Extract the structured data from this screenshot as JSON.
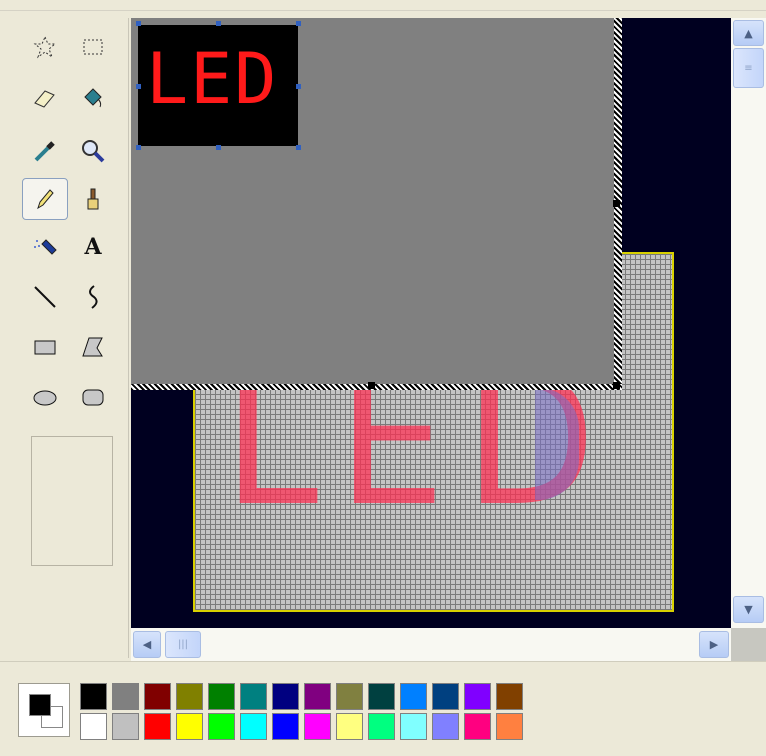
{
  "tools": [
    {
      "name": "free-select-icon"
    },
    {
      "name": "rect-select-icon"
    },
    {
      "name": "eraser-icon"
    },
    {
      "name": "fill-bucket-icon"
    },
    {
      "name": "color-picker-icon"
    },
    {
      "name": "magnifier-icon"
    },
    {
      "name": "pencil-icon",
      "selected": true
    },
    {
      "name": "brush-icon"
    },
    {
      "name": "airbrush-icon"
    },
    {
      "name": "text-icon"
    },
    {
      "name": "line-icon"
    },
    {
      "name": "curve-icon"
    },
    {
      "name": "rectangle-icon"
    },
    {
      "name": "polygon-icon"
    },
    {
      "name": "ellipse-icon"
    },
    {
      "name": "rounded-rect-icon"
    }
  ],
  "text_tool_glyph": "A",
  "canvas": {
    "small_label": "LED",
    "big_label": "LED",
    "background": "#000020",
    "paper_color": "#808080",
    "grid_border": "#d8d000",
    "led_color": "#ff1a1a"
  },
  "scrollbar": {
    "up_arrow": "▲",
    "down_arrow": "▼",
    "left_arrow": "◀",
    "right_arrow": "▶"
  },
  "colors": {
    "foreground": "#000000",
    "background": "#ffffff"
  },
  "palette": [
    [
      "#000000",
      "#808080",
      "#800000",
      "#808000",
      "#008000",
      "#008080",
      "#000080",
      "#800080",
      "#808040",
      "#004040",
      "#0080ff",
      "#004080",
      "#8000ff",
      "#804000"
    ],
    [
      "#ffffff",
      "#c0c0c0",
      "#ff0000",
      "#ffff00",
      "#00ff00",
      "#00ffff",
      "#0000ff",
      "#ff00ff",
      "#ffff80",
      "#00ff80",
      "#80ffff",
      "#8080ff",
      "#ff0080",
      "#ff8040"
    ]
  ]
}
